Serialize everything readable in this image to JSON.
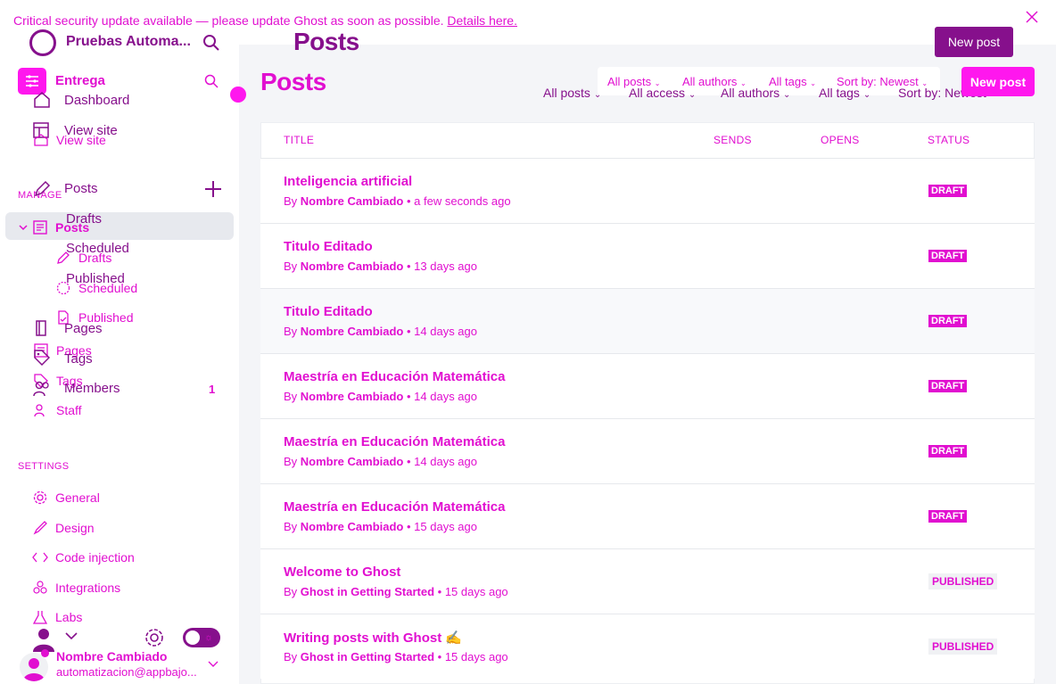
{
  "banner": {
    "text": "Critical security update available — please update Ghost as soon as possible.",
    "link": "Details here."
  },
  "sidebar": {
    "site_title": "Pruebas Automa...",
    "workspace": "Entrega",
    "dashboard": "Dashboard",
    "view_site": "View site",
    "view_site_ghost": "View site",
    "manage_title": "MANAGE",
    "posts": "Posts",
    "posts_ghost": "Posts",
    "drafts": "Drafts",
    "drafts_ghost": "Drafts",
    "scheduled": "Scheduled",
    "scheduled_ghost": "Scheduled",
    "published": "Published",
    "published_ghost": "Published",
    "pages": "Pages",
    "pages_ghost": "Pages",
    "tags": "Tags",
    "tags_ghost": "Tags",
    "members": "Members",
    "members_count": "1",
    "staff": "Staff",
    "settings_title": "SETTINGS",
    "general": "General",
    "design": "Design",
    "code_injection": "Code injection",
    "integrations": "Integrations",
    "labs": "Labs",
    "user_name": "Nombre Cambiado",
    "user_email": "automatizacion@appbajo..."
  },
  "header": {
    "title_top": "Posts",
    "title": "Posts",
    "new_post_top": "New post",
    "new_post": "New post",
    "filters": {
      "all_posts": "All posts",
      "all_authors": "All authors",
      "all_tags": "All tags",
      "sort": "Sort by: Newest"
    },
    "filters_ghost": {
      "all_posts": "All posts",
      "all_access": "All access",
      "all_authors": "All authors",
      "all_tags": "All tags",
      "sort": "Sort by: Newest"
    }
  },
  "table": {
    "headers": {
      "title": "TITLE",
      "sends": "SENDS",
      "opens": "OPENS",
      "status": "STATUS"
    },
    "rows": [
      {
        "title": "Inteligencia artificial",
        "by": "By",
        "author": "Nombre Cambiado",
        "time": "• a few seconds ago",
        "status": "DRAFT"
      },
      {
        "title": "Titulo Editado",
        "by": "By",
        "author": "Nombre Cambiado",
        "time": "• 13 days ago",
        "status": "DRAFT"
      },
      {
        "title": "Titulo Editado",
        "by": "By",
        "author": "Nombre Cambiado",
        "time": "• 14 days ago",
        "status": "DRAFT"
      },
      {
        "title": "Maestría en Educación Matemática",
        "by": "By",
        "author": "Nombre Cambiado",
        "time": "• 14 days ago",
        "status": "DRAFT"
      },
      {
        "title": "Maestría en Educación Matemática",
        "by": "By",
        "author": "Nombre Cambiado",
        "time": "• 14 days ago",
        "status": "DRAFT"
      },
      {
        "title": "Maestría en Educación Matemática",
        "by": "By",
        "author": "Nombre Cambiado",
        "time": "• 15 days ago",
        "status": "DRAFT"
      },
      {
        "title": "Welcome to Ghost",
        "by": "By",
        "author": "Ghost in Getting Started",
        "time": "• 15 days ago",
        "status": "PUBLISHED"
      },
      {
        "title": "Writing posts with Ghost ✍️",
        "by": "By",
        "author": "Ghost in Getting Started",
        "time": "• 15 days ago",
        "status": "PUBLISHED"
      }
    ]
  },
  "colors": {
    "accent": "#e10fd0",
    "dark_accent": "#86108c",
    "bright_button": "#ff17ee",
    "active_bg": "#e7e9ee",
    "main_bg": "#f4f5f8"
  }
}
